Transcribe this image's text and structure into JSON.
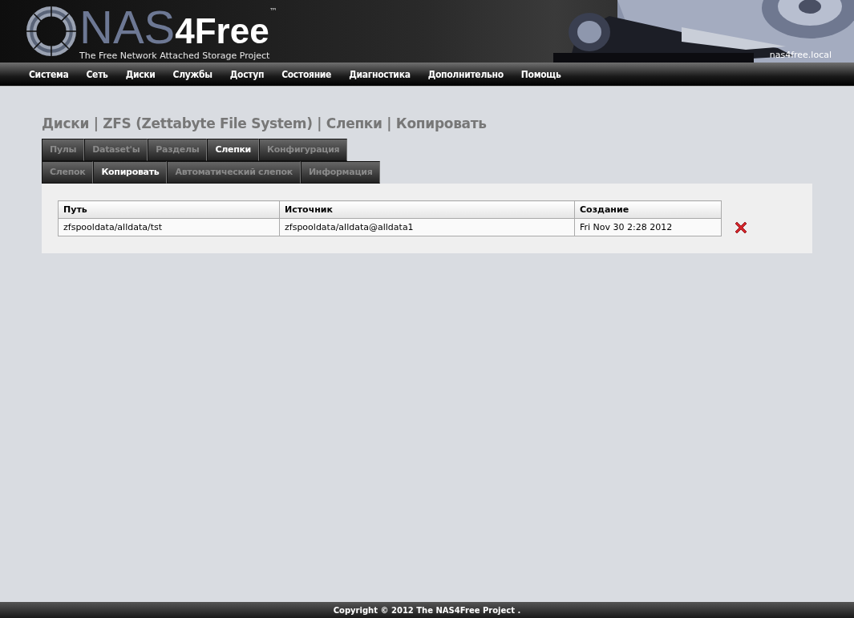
{
  "header": {
    "logo": {
      "name": "NAS",
      "suffix": "4Free",
      "trademark": "™"
    },
    "tagline": "The Free Network Attached Storage Project",
    "hostname": "nas4free.local"
  },
  "menu": [
    "Система",
    "Сеть",
    "Диски",
    "Службы",
    "Доступ",
    "Состояние",
    "Диагностика",
    "Дополнительно",
    "Помощь"
  ],
  "page_title": "Диски | ZFS (Zettabyte File System) | Слепки | Копировать",
  "tabs": [
    {
      "label": "Пулы",
      "selected": false
    },
    {
      "label": "Dataset'ы",
      "selected": false
    },
    {
      "label": "Разделы",
      "selected": false
    },
    {
      "label": "Слепки",
      "selected": true
    },
    {
      "label": "Конфигурация",
      "selected": false
    }
  ],
  "subtabs": [
    {
      "label": "Слепок",
      "selected": false
    },
    {
      "label": "Копировать",
      "selected": true
    },
    {
      "label": "Автоматический слепок",
      "selected": false
    },
    {
      "label": "Информация",
      "selected": false
    }
  ],
  "table": {
    "columns": [
      "Путь",
      "Источник",
      "Создание"
    ],
    "rows": [
      [
        "zfspooldata/alldata/tst",
        "zfspooldata/alldata@alldata1",
        "Fri Nov 30 2:28 2012"
      ]
    ]
  },
  "footer": "Copyright © 2012 The NAS4Free Project ."
}
